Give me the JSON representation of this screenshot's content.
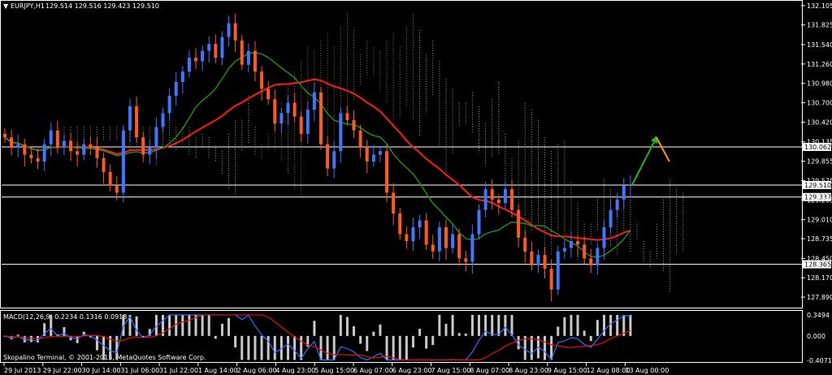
{
  "header": {
    "symbol": "EURJPY,H1",
    "ohlc": "129.514 129.516 129.423 129.510"
  },
  "macd_title": "MACD(12,26,9) 0.2234 0.1316 0.0918",
  "copyright": "Skopalino Terminal, © 2001-2013, MetaQuotes Software Corp.",
  "colors": {
    "background": "#000000",
    "bull": "#3c78ff",
    "bear": "#ff5a1e",
    "ma_red": "#ff1a1a",
    "ma_green": "#1e8c1e",
    "cloud": "#c8c8c8",
    "cloud_warm": "#c88c50",
    "macd_hist": "#c8c8c8",
    "macd_main": "#3a6cff",
    "macd_signal": "#e01010"
  },
  "chart_data": {
    "type": "candlestick",
    "symbol": "EURJPY",
    "timeframe": "H1",
    "last_ohlc": {
      "open": 129.514,
      "high": 129.516,
      "low": 129.423,
      "close": 129.51
    },
    "ylim": [
      127.75,
      132.15
    ],
    "y_ticks": [
      "132.105",
      "131.825",
      "131.540",
      "131.260",
      "130.980",
      "130.700",
      "130.420",
      "130.135",
      "129.855",
      "129.575",
      "129.295",
      "129.010",
      "128.735",
      "128.450",
      "128.170",
      "127.890"
    ],
    "x_ticks": [
      "29 Jul 2013",
      "29 Jul 22:00",
      "30 Jul 14:00",
      "31 Jul 06:00",
      "31 Jul 22:00",
      "1 Aug 14:00",
      "2 Aug 06:00",
      "4 Aug 23:00",
      "5 Aug 15:00",
      "6 Aug 07:00",
      "6 Aug 23:00",
      "7 Aug 15:00",
      "8 Aug 07:00",
      "8 Aug 23:00",
      "9 Aug 15:00",
      "12 Aug 08:00",
      "13 Aug 00:00"
    ],
    "hlines": [
      {
        "label": "130.062",
        "value": 130.062
      },
      {
        "label": "129.510",
        "value": 129.51
      },
      {
        "label": "129.337",
        "value": 129.337
      },
      {
        "label": "128.365",
        "value": 128.365
      }
    ],
    "closes": [
      130.2,
      130.05,
      130.1,
      129.95,
      129.9,
      129.85,
      130.1,
      130.3,
      130.05,
      130.15,
      130.0,
      129.95,
      130.1,
      130.05,
      129.9,
      129.7,
      129.5,
      129.4,
      130.3,
      130.65,
      130.2,
      129.95,
      130.05,
      130.35,
      130.55,
      130.8,
      131.0,
      131.15,
      131.35,
      131.3,
      131.45,
      131.55,
      131.35,
      131.65,
      131.85,
      131.6,
      131.25,
      131.45,
      131.15,
      130.9,
      130.75,
      130.4,
      130.55,
      130.7,
      130.5,
      130.25,
      130.6,
      130.85,
      130.1,
      129.75,
      130.0,
      130.55,
      130.45,
      130.3,
      130.05,
      129.85,
      129.95,
      130.0,
      129.4,
      129.1,
      128.8,
      128.7,
      128.9,
      129.0,
      128.65,
      128.55,
      128.9,
      128.6,
      128.8,
      128.45,
      128.4,
      128.8,
      129.15,
      129.45,
      129.3,
      129.25,
      129.45,
      129.15,
      128.75,
      128.55,
      128.35,
      128.5,
      128.3,
      128.0,
      128.55,
      128.6,
      128.7,
      128.65,
      128.45,
      128.35,
      128.6,
      128.9,
      129.15,
      129.3,
      129.5,
      129.51
    ],
    "projection": [
      {
        "type": "up",
        "from": 129.51,
        "to": 130.2
      },
      {
        "type": "down",
        "from": 130.2,
        "to": 129.85
      }
    ],
    "macd": {
      "label": "MACD(12,26,9)",
      "values": {
        "main": 0.2234,
        "signal": 0.1316,
        "histogram": 0.0918
      },
      "y_ticks": [
        "0.3494",
        "0.000",
        "-0.4071"
      ]
    }
  }
}
